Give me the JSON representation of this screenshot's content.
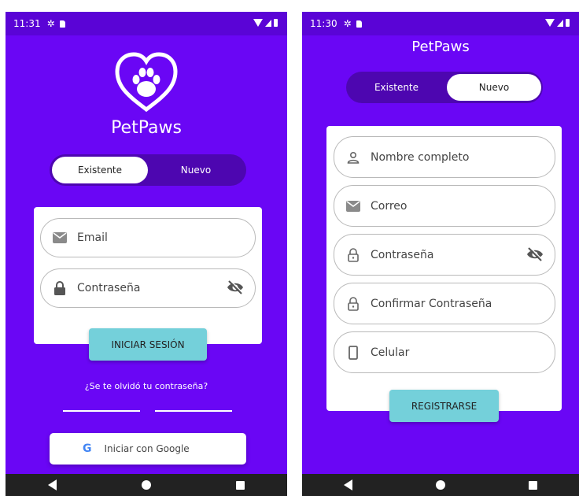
{
  "left": {
    "status_time": "11:31",
    "brand": "PetPaws",
    "toggle": {
      "existing": "Existente",
      "new": "Nuevo"
    },
    "email_placeholder": "Email",
    "password_placeholder": "Contraseña",
    "login_button": "INICIAR SESIÓN",
    "forgot_link": "¿Se te olvidó tu contraseña?",
    "google_button": "Iniciar con Google",
    "google_letter": "G"
  },
  "right": {
    "status_time": "11:30",
    "brand": "PetPaws",
    "toggle": {
      "existing": "Existente",
      "new": "Nuevo"
    },
    "fields": {
      "name": "Nombre completo",
      "email": "Correo",
      "password": "Contraseña",
      "confirm": "Confirmar Contraseña",
      "phone": "Celular"
    },
    "register_button": "REGISTRARSE"
  },
  "colors": {
    "primary": "#6a06f5",
    "statusbar": "#5a04d6",
    "toggle_bg": "#4d06b0",
    "button": "#74d0da"
  }
}
